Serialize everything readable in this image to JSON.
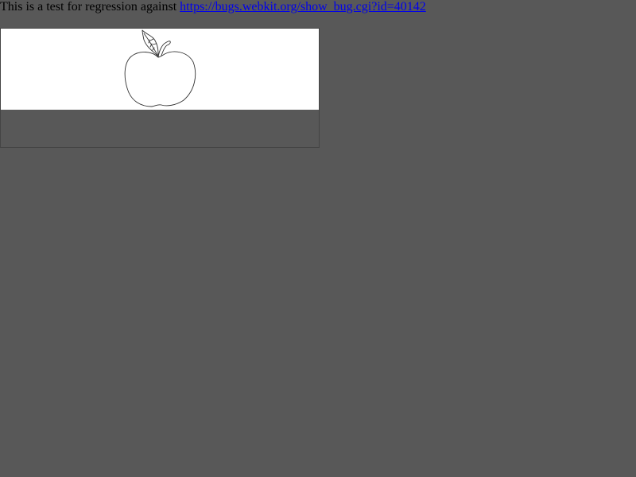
{
  "intro": {
    "text": "This is a test for regression against ",
    "link_text": "https://bugs.webkit.org/show_bug.cgi?id=40142",
    "link_color": "#0000ee"
  },
  "frame": {
    "image_icon": "apple-outline-icon",
    "canvas_color": "#ffffff",
    "backdrop_color": "#585858"
  }
}
